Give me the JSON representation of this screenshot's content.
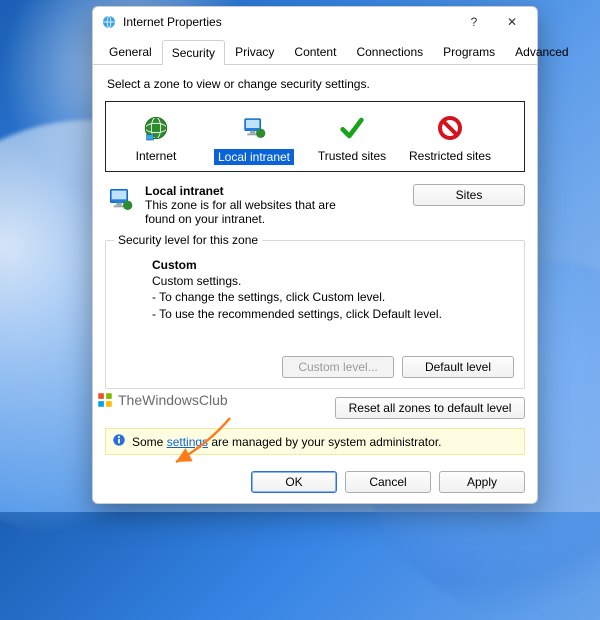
{
  "window": {
    "title": "Internet Properties",
    "help": "?",
    "close": "✕"
  },
  "tabs": [
    "General",
    "Security",
    "Privacy",
    "Content",
    "Connections",
    "Programs",
    "Advanced"
  ],
  "active_tab": 1,
  "zone_prompt": "Select a zone to view or change security settings.",
  "zones": {
    "items": [
      {
        "label": "Internet"
      },
      {
        "label": "Local intranet"
      },
      {
        "label": "Trusted sites"
      },
      {
        "label": "Restricted sites"
      }
    ],
    "selected": 1
  },
  "zone_detail": {
    "title": "Local intranet",
    "desc": "This zone is for all websites that are found on your intranet.",
    "sites_btn": "Sites"
  },
  "group": {
    "legend": "Security level for this zone",
    "heading": "Custom",
    "line1": "Custom settings.",
    "line2": "- To change the settings, click Custom level.",
    "line3": "- To use the recommended settings, click Default level.",
    "custom_level_btn": "Custom level...",
    "default_level_btn": "Default level",
    "reset_btn": "Reset all zones to default level"
  },
  "watermark": "TheWindowsClub",
  "infobar": {
    "prefix": "Some ",
    "link": "settings",
    "suffix": " are managed by your system administrator."
  },
  "buttons": {
    "ok": "OK",
    "cancel": "Cancel",
    "apply": "Apply"
  }
}
